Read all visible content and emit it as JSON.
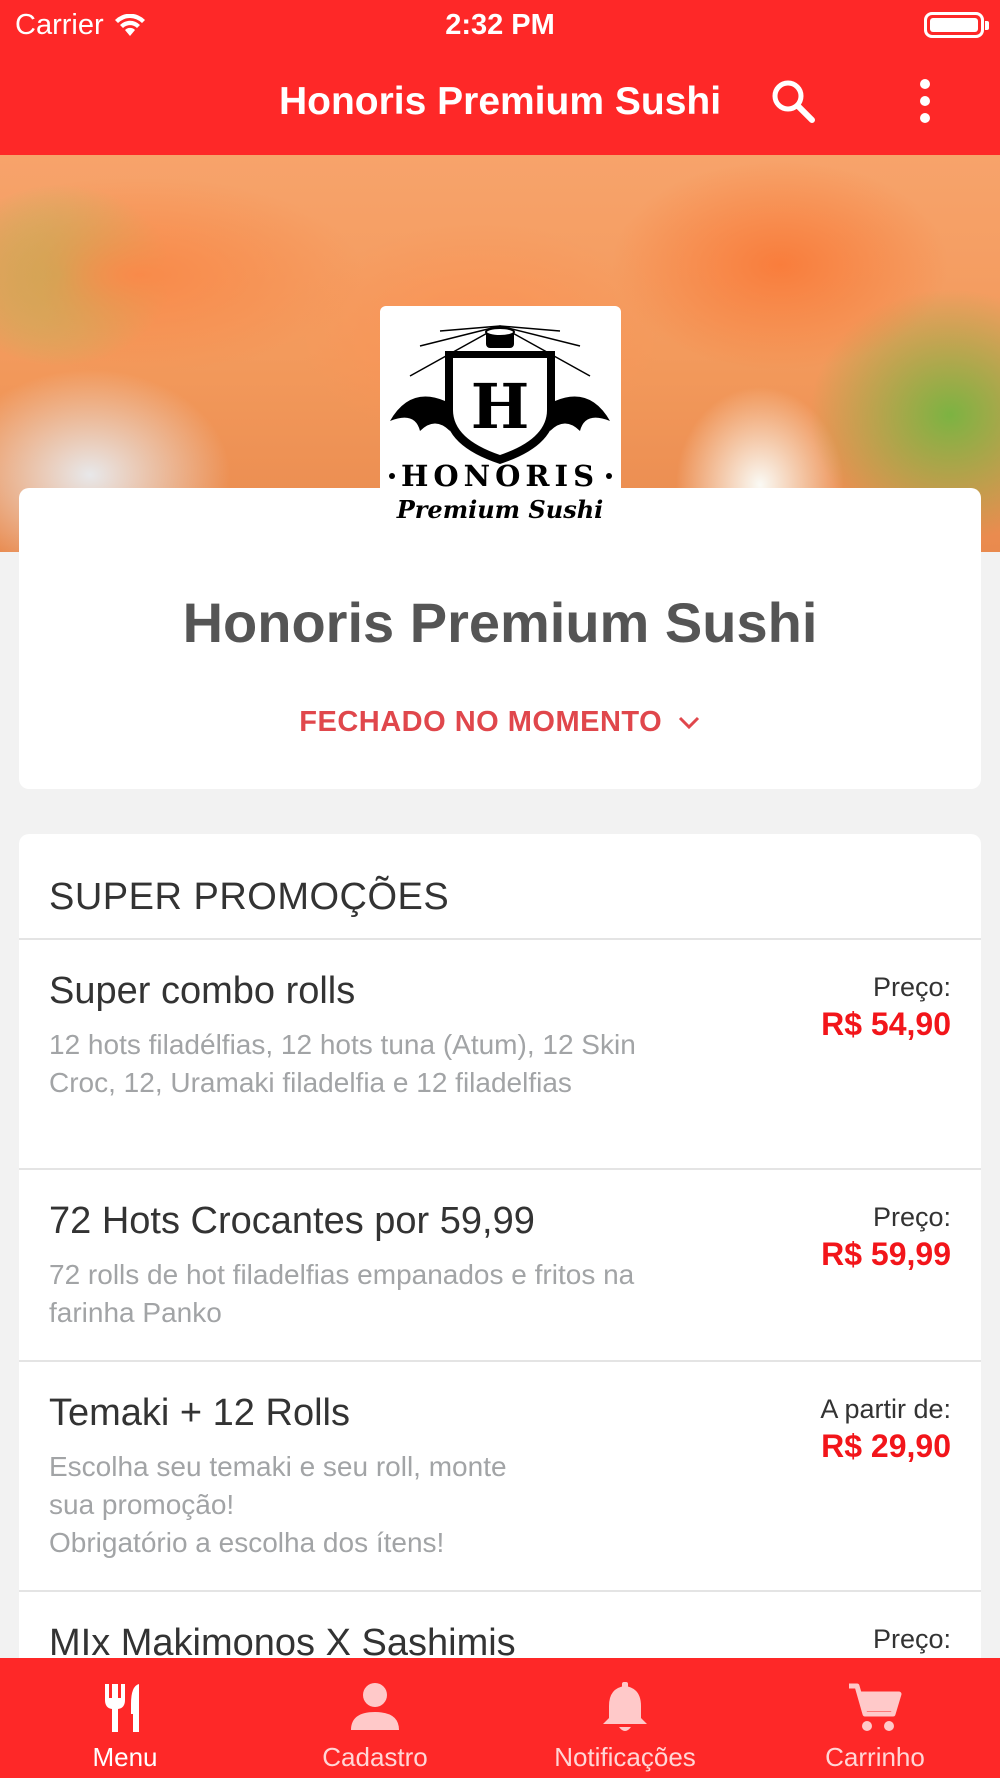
{
  "status_bar": {
    "carrier": "Carrier",
    "time": "2:32 PM"
  },
  "nav": {
    "title": "Honoris Premium Sushi",
    "search_icon": "search-icon",
    "more_icon": "more-vertical-icon"
  },
  "logo": {
    "brand": "HONORIS",
    "tagline": "Premium Sushi",
    "letter": "H"
  },
  "restaurant": {
    "name": "Honoris Premium Sushi",
    "status": "FECHADO NO MOMENTO"
  },
  "menu": {
    "section_title": "SUPER PROMOÇÕES",
    "items": [
      {
        "name": "Super combo rolls",
        "desc_lines": [
          "12 hots filadélfias, 12 hots tuna (Atum), 12 Skin",
          "Croc, 12, Uramaki filadelfia e 12 filadelfias"
        ],
        "price_label": "Preço:",
        "price": "R$ 54,90"
      },
      {
        "name": "72 Hots Crocantes por 59,99",
        "desc_lines": [
          "72 rolls de hot filadelfias empanados e fritos na",
          "farinha Panko"
        ],
        "price_label": "Preço:",
        "price": "R$ 59,99"
      },
      {
        "name": "Temaki + 12 Rolls",
        "desc_lines": [
          "Escolha seu temaki e seu roll, monte",
          "sua promoção!",
          "Obrigatório a escolha dos ítens!"
        ],
        "price_label": "A partir de:",
        "price": "R$ 29,90"
      },
      {
        "name": "MIx Makimonos X Sashimis",
        "desc_lines": [],
        "price_label": "Preço:",
        "price": ""
      }
    ]
  },
  "tabs": [
    {
      "label": "Menu",
      "icon": "fork-knife-icon",
      "active": true
    },
    {
      "label": "Cadastro",
      "icon": "person-icon",
      "active": false
    },
    {
      "label": "Notificações",
      "icon": "bell-icon",
      "active": false
    },
    {
      "label": "Carrinho",
      "icon": "cart-icon",
      "active": false
    }
  ],
  "colors": {
    "primary": "#fe2828",
    "price": "#f2151a",
    "status": "#e0474c"
  }
}
